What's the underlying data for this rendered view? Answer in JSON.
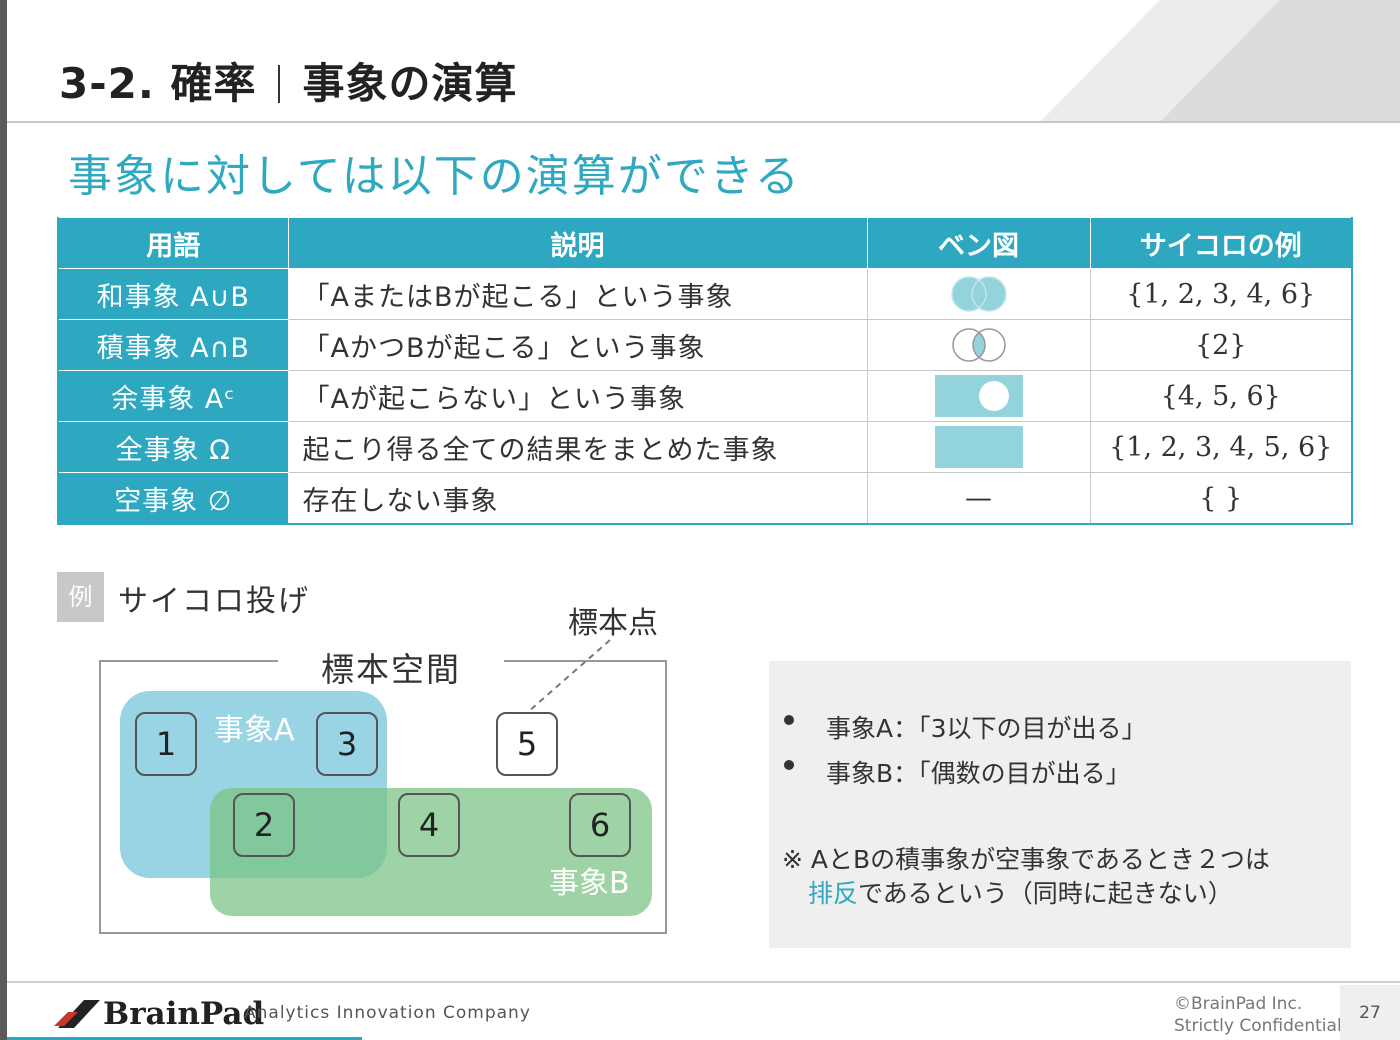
{
  "header": {
    "section": "3-2. 確率",
    "title": "事象の演算"
  },
  "subtitle": "事象に対しては以下の演算ができる",
  "table": {
    "headers": [
      "用語",
      "説明",
      "ベン図",
      "サイコロの例"
    ],
    "rows": [
      {
        "term": "和事象 A∪B",
        "desc": "「AまたはBが起こる」という事象",
        "venn": "union",
        "example": "{1, 2, 3, 4, 6}"
      },
      {
        "term": "積事象 A∩B",
        "desc": "「AかつBが起こる」という事象",
        "venn": "intersection",
        "example": "{2}"
      },
      {
        "term": "余事象 Aᶜ",
        "desc": "「Aが起こらない」という事象",
        "venn": "complement",
        "example": "{4, 5, 6}"
      },
      {
        "term": "全事象 Ω",
        "desc": "起こり得る全ての結果をまとめた事象",
        "venn": "whole",
        "example": "{1, 2, 3, 4, 5, 6}"
      },
      {
        "term": "空事象 ∅",
        "desc": "存在しない事象",
        "venn": "—",
        "example": "{ }"
      }
    ]
  },
  "example": {
    "badge": "例",
    "label": "サイコロ投げ",
    "sample_point": "標本点",
    "sample_space": "標本空間",
    "event_a": "事象A",
    "event_b": "事象B",
    "dice": [
      "1",
      "2",
      "3",
      "4",
      "5",
      "6"
    ]
  },
  "info": {
    "bullet_a": "事象A：「3以下の目が出る」",
    "bullet_b": "事象B：「偶数の目が出る」",
    "note_line1": "※ AとBの積事象が空事象であるとき２つは",
    "note_hl": "排反",
    "note_line2": "であるという（同時に起きない）"
  },
  "footer": {
    "logo": "BrainPad",
    "tagline": "Analytics Innovation Company",
    "copyright": "©BrainPad Inc.",
    "confidential": "Strictly Confidential",
    "page": "27"
  },
  "colors": {
    "accent": "#2ea8c1",
    "venn_fill": "#93d3dc",
    "event_b": "#78c482"
  }
}
